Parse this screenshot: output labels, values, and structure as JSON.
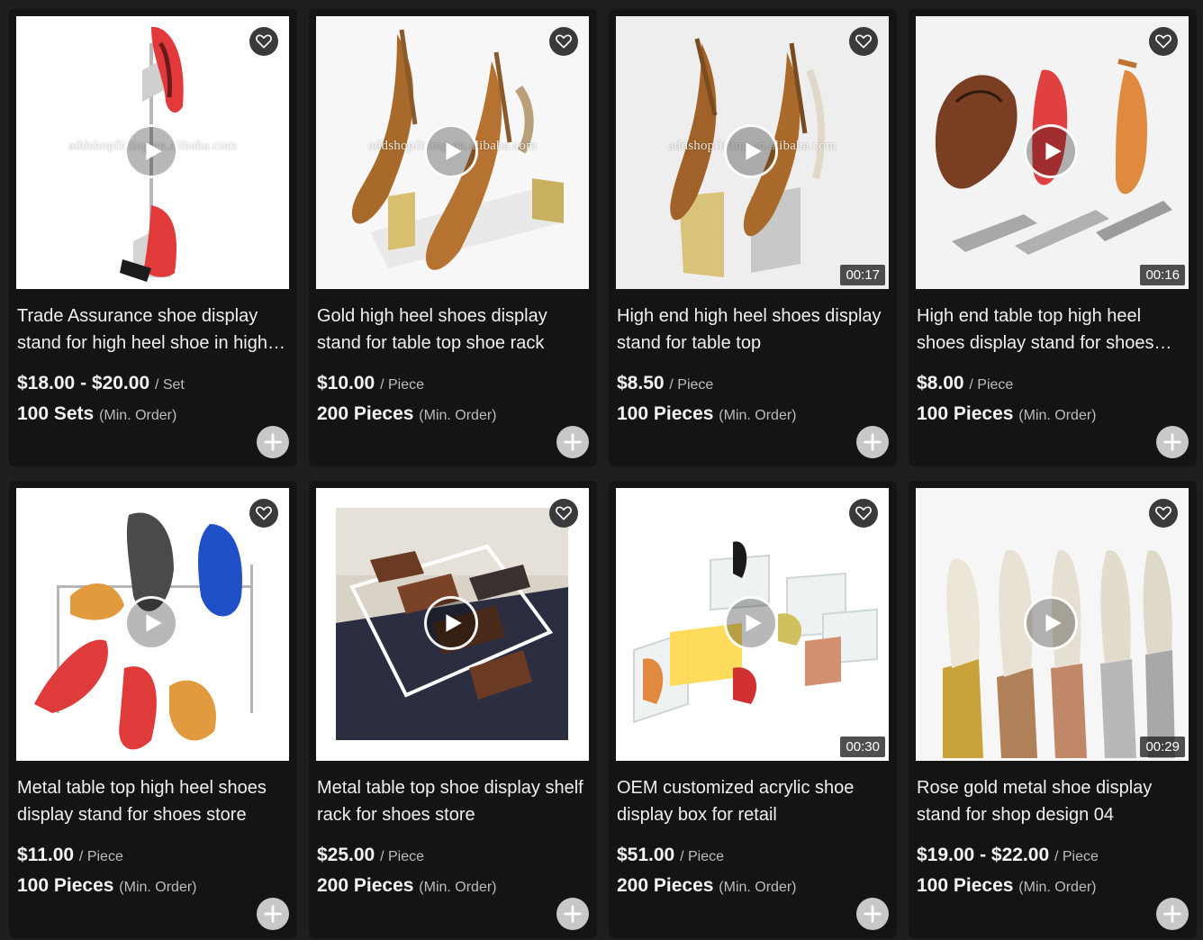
{
  "products": [
    {
      "title": "Trade Assurance shoe display stand for high heel shoe in high-end store",
      "price": "$18.00 - $20.00",
      "unit": "/ Set",
      "moq": "100 Sets",
      "moq_note": "(Min. Order)",
      "watermark": "addshopfitting.en.alibaba.com",
      "duration": "",
      "icons": [
        "heart-icon",
        "play-icon",
        "plus-icon"
      ]
    },
    {
      "title": "Gold high heel shoes display stand for table top shoe rack",
      "price": "$10.00",
      "unit": "/ Piece",
      "moq": "200 Pieces",
      "moq_note": "(Min. Order)",
      "watermark": "addshopfitting.en.alibaba.com",
      "duration": "",
      "icons": [
        "heart-icon",
        "play-icon",
        "plus-icon"
      ]
    },
    {
      "title": "High end high heel shoes display stand for table top",
      "price": "$8.50",
      "unit": "/ Piece",
      "moq": "100 Pieces",
      "moq_note": "(Min. Order)",
      "watermark": "addshopfitting.en.alibaba.com",
      "duration": "00:17",
      "icons": [
        "heart-icon",
        "play-icon",
        "plus-icon"
      ]
    },
    {
      "title": "High end table top high heel shoes display stand for shoes store",
      "price": "$8.00",
      "unit": "/ Piece",
      "moq": "100 Pieces",
      "moq_note": "(Min. Order)",
      "watermark": "",
      "duration": "00:16",
      "icons": [
        "heart-icon",
        "play-icon",
        "plus-icon"
      ]
    },
    {
      "title": "Metal table top high heel shoes display stand for shoes store",
      "price": "$11.00",
      "unit": "/ Piece",
      "moq": "100 Pieces",
      "moq_note": "(Min. Order)",
      "watermark": "",
      "duration": "",
      "icons": [
        "heart-icon",
        "play-icon",
        "plus-icon"
      ]
    },
    {
      "title": "Metal table top shoe display shelf rack for shoes store",
      "price": "$25.00",
      "unit": "/ Piece",
      "moq": "200 Pieces",
      "moq_note": "(Min. Order)",
      "watermark": "",
      "duration": "",
      "icons": [
        "heart-icon",
        "play-icon",
        "plus-icon"
      ]
    },
    {
      "title": "OEM customized acrylic shoe display box for retail",
      "price": "$51.00",
      "unit": "/ Piece",
      "moq": "200 Pieces",
      "moq_note": "(Min. Order)",
      "watermark": "",
      "duration": "00:30",
      "icons": [
        "heart-icon",
        "play-icon",
        "plus-icon"
      ]
    },
    {
      "title": "Rose gold metal shoe display stand for shop design 04",
      "price": "$19.00 - $22.00",
      "unit": "/ Piece",
      "moq": "100 Pieces",
      "moq_note": "(Min. Order)",
      "watermark": "",
      "duration": "00:29",
      "icons": [
        "heart-icon",
        "play-icon",
        "plus-icon"
      ]
    }
  ],
  "colors": {
    "page_bg": "#1e1e1f",
    "card_bg": "#141415",
    "text": "#f0f0f0",
    "muted": "#bdbdbd"
  }
}
